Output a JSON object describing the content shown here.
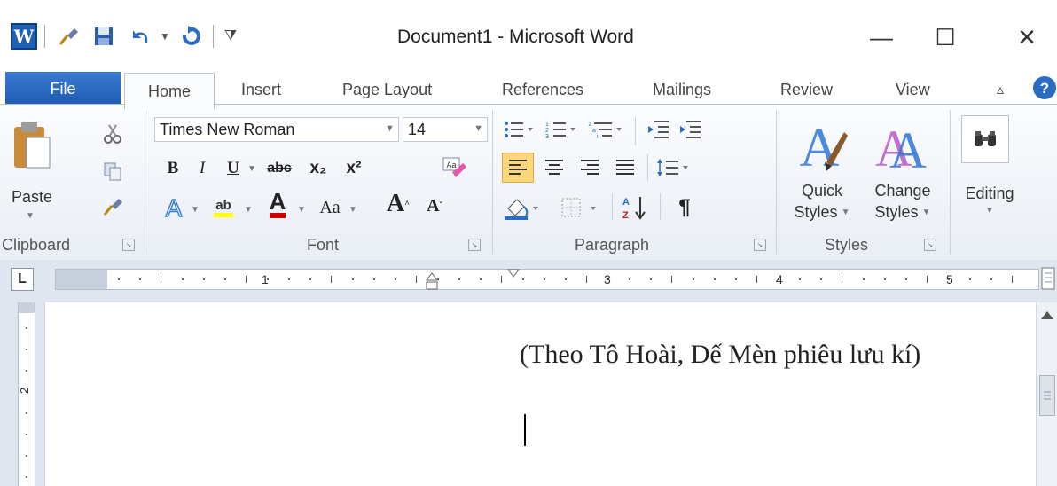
{
  "window": {
    "title": "Document1 - Microsoft Word",
    "app_logo": "W",
    "minimize_glyph": "—",
    "maximize_glyph": "☐",
    "close_glyph": "✕"
  },
  "quick_access": {
    "customize_glyph": "⧩"
  },
  "tabs": {
    "file": "File",
    "items": [
      "Home",
      "Insert",
      "Page Layout",
      "References",
      "Mailings",
      "Review",
      "View"
    ]
  },
  "ribbon": {
    "clipboard": {
      "label": "Clipboard",
      "paste": "Paste"
    },
    "font": {
      "label": "Font",
      "font_name": "Times New Roman",
      "font_size": "14",
      "bold": "B",
      "italic": "I",
      "underline": "U",
      "strike": "abc",
      "subscript": "x₂",
      "superscript": "x²",
      "change_case": "Aa",
      "grow": "A",
      "shrink": "A",
      "highlight": "ab",
      "color_letter": "A"
    },
    "paragraph": {
      "label": "Paragraph",
      "pilcrow": "¶"
    },
    "styles": {
      "label": "Styles",
      "quick_styles_1": "Quick",
      "quick_styles_2": "Styles",
      "change_styles_1": "Change",
      "change_styles_2": "Styles"
    },
    "editing": {
      "label": "Editing"
    }
  },
  "ruler": {
    "numbers": [
      "1",
      "3",
      "4",
      "5"
    ]
  },
  "vruler": {
    "number": "2"
  },
  "document": {
    "line": "(Theo Tô Hoài, Dế Mèn phiêu lưu kí)"
  },
  "colors": {
    "file_tab": "#2a6cc4",
    "highlight_yellow": "#ffff00",
    "font_red": "#d00000",
    "align_left_active": "#fcd67a"
  }
}
